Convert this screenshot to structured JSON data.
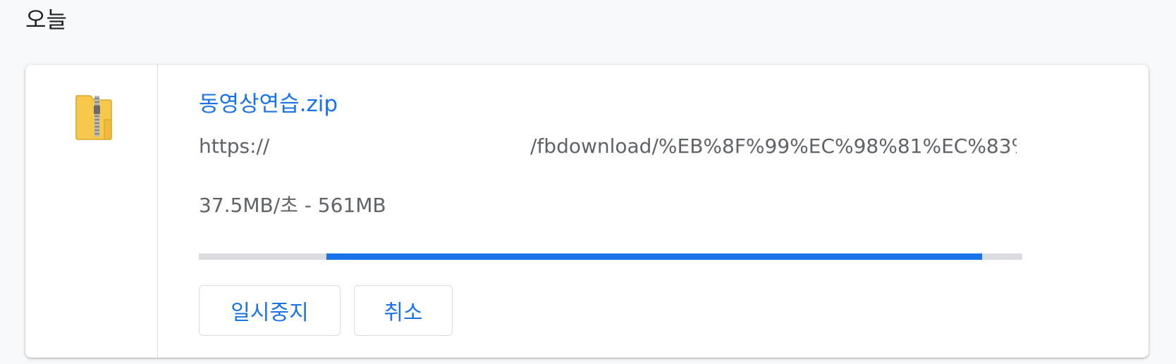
{
  "section": {
    "title": "오늘"
  },
  "download": {
    "file_icon": "zip-folder-icon",
    "file_name": "동영상연습.zip",
    "url_prefix": "https://",
    "url_tail": "/fbdownload/%EB%8F%99%EC%98%81%EC%83%…",
    "status": "37.5MB/초 - 561MB",
    "progress": {
      "start_fraction": 0.155,
      "end_fraction": 0.951
    },
    "buttons": {
      "pause_label": "일시중지",
      "cancel_label": "취소"
    }
  },
  "colors": {
    "accent": "#1a73e8",
    "track": "#dadce0",
    "text_secondary": "#5f6368",
    "background": "#f8f9fa",
    "card": "#ffffff"
  }
}
